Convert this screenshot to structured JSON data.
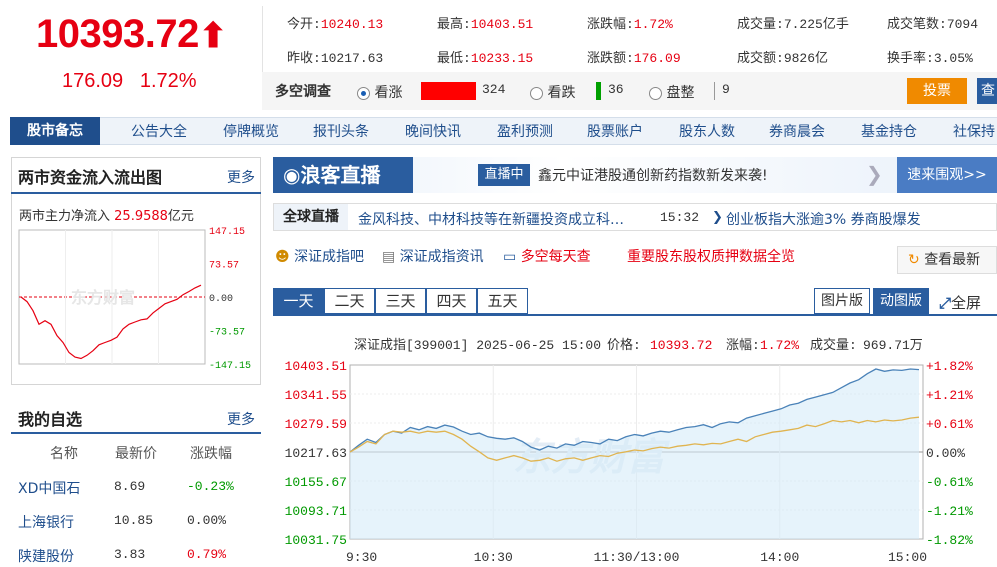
{
  "quote": {
    "price": "10393.72",
    "arrow": "⬆",
    "change": "176.09",
    "change_pct": "1.72%"
  },
  "stats": [
    {
      "label": "今开:",
      "value": "10240.13",
      "color": "red"
    },
    {
      "label": "最高:",
      "value": "10403.51",
      "color": "red"
    },
    {
      "label": "涨跌幅:",
      "value": "1.72%",
      "color": "red"
    },
    {
      "label": "成交量:",
      "value": "7.225亿手",
      "color": "black"
    },
    {
      "label": "成交笔数:",
      "value": "7094",
      "color": "black"
    },
    {
      "label": "昨收:",
      "value": "10217.63",
      "color": "black"
    },
    {
      "label": "最低:",
      "value": "10233.15",
      "color": "red"
    },
    {
      "label": "涨跌额:",
      "value": "176.09",
      "color": "red"
    },
    {
      "label": "成交额:",
      "value": "9826亿",
      "color": "black"
    },
    {
      "label": "换手率:",
      "value": "3.05%",
      "color": "black"
    }
  ],
  "poll": {
    "title": "多空调查",
    "bull_label": "看涨",
    "bull_count": "324",
    "bear_label": "看跌",
    "bear_count": "36",
    "flat_label": "盘整",
    "flat_count": "9",
    "vote_button": "投票",
    "extra_button": "查"
  },
  "nav": {
    "title": "股市备忘",
    "items": [
      "公告大全",
      "停牌概览",
      "报刊头条",
      "晚间快讯",
      "盈利预测",
      "股票账户",
      "股东人数",
      "券商晨会",
      "基金持仓",
      "社保持"
    ]
  },
  "flow_panel": {
    "title": "两市资金流入流出图",
    "more": "更多",
    "subtitle_prefix": "两市主力净流入",
    "net_value": "25.9588",
    "unit": "亿元",
    "y_ticks": [
      "147.15",
      "73.57",
      "0.00",
      "-73.57",
      "-147.15"
    ],
    "watermark": "东方财富"
  },
  "watchlist": {
    "title": "我的自选",
    "more": "更多",
    "headers": [
      "名称",
      "最新价",
      "涨跌幅"
    ],
    "rows": [
      {
        "name": "XD中国石",
        "price": "8.69",
        "pct": "-0.23%",
        "color": "green"
      },
      {
        "name": "上海银行",
        "price": "10.85",
        "pct": "0.00%",
        "color": "black"
      },
      {
        "name": "陕建股份",
        "price": "3.83",
        "pct": "0.79%",
        "color": "red"
      }
    ]
  },
  "banner": {
    "logo": "浪客直播",
    "tag": "直播中",
    "headline": "鑫元中证港股通创新药指数新发来袭!",
    "cta": "速来围观>>"
  },
  "ticker": {
    "label": "全球直播",
    "text": "金风科技、中材科技等在新疆投资成立科…",
    "time": "15:32",
    "text2": "创业板指大涨逾3% 券商股爆发"
  },
  "links": {
    "l1": "深证成指吧",
    "l2": "深证成指资讯",
    "l3": "多空每天查",
    "l4": "重要股东股权质押数据全览",
    "refresh": "查看最新"
  },
  "period_tabs": [
    "一天",
    "二天",
    "三天",
    "四天",
    "五天"
  ],
  "view_tabs": {
    "static": "图片版",
    "dynamic": "动图版",
    "fullscreen": "全屏"
  },
  "chart_data": {
    "type": "line",
    "title": "深证成指[399001] 2025-06-25 15:00",
    "info": {
      "price_label": "价格:",
      "price": "10393.72",
      "pct_label": "涨幅:",
      "pct": "1.72%",
      "vol_label": "成交量:",
      "vol": "969.71万"
    },
    "y_ticks_left": [
      "10403.51",
      "10341.55",
      "10279.59",
      "10217.63",
      "10155.67",
      "10093.71",
      "10031.75"
    ],
    "y_ticks_right": [
      "+1.82%",
      "+1.21%",
      "+0.61%",
      "0.00%",
      "-0.61%",
      "-1.21%",
      "-1.82%"
    ],
    "x_ticks": [
      "9:30",
      "10:30",
      "11:30/13:00",
      "14:00",
      "15:00"
    ],
    "ylim": [
      10031.75,
      10403.51
    ],
    "baseline": 10217.63,
    "watermark": "东方财富",
    "series": [
      {
        "values": [
          10217.63,
          10232,
          10245,
          10238,
          10255,
          10262,
          10258,
          10270,
          10265,
          10272,
          10268,
          10275,
          10271,
          10262,
          10255,
          10258,
          10250,
          10247,
          10245,
          10248,
          10240,
          10228,
          10222,
          10230,
          10226,
          10235,
          10232,
          10240,
          10238,
          10235,
          10245,
          10242,
          10250,
          10255,
          10252,
          10258,
          10262,
          10260,
          10265,
          10270,
          10272,
          10276,
          10270,
          10278,
          10282,
          10280,
          10290,
          10295,
          10300,
          10305,
          10310,
          10318,
          10322,
          10330,
          10335,
          10340,
          10345,
          10355,
          10365,
          10372,
          10385,
          10395,
          10390,
          10393,
          10392,
          10395,
          10393.72
        ]
      },
      {
        "values": [
          10217.63,
          10228,
          10240,
          10235,
          10255,
          10262,
          10260,
          10262,
          10258,
          10262,
          10260,
          10262,
          10255,
          10245,
          10230,
          10218,
          10205,
          10200,
          10205,
          10210,
          10205,
          10198,
          10200,
          10205,
          10198,
          10203,
          10205,
          10200,
          10205,
          10210,
          10208,
          10215,
          10218,
          10222,
          10220,
          10225,
          10228,
          10226,
          10230,
          10232,
          10235,
          10233,
          10236,
          10235,
          10240,
          10245,
          10240,
          10250,
          10255,
          10260,
          10262,
          10265,
          10268,
          10275,
          10272,
          10278,
          10285,
          10282,
          10285,
          10280,
          10285,
          10282,
          10286,
          10284,
          10286,
          10290,
          10292
        ]
      }
    ]
  },
  "flow_series": [
    0,
    -10,
    -30,
    -60,
    -52,
    -60,
    -85,
    -100,
    -122,
    -132,
    -135,
    -128,
    -118,
    -105,
    -100,
    -95,
    -88,
    -70,
    -60,
    -55,
    -50,
    -48,
    -35,
    -25,
    -15,
    -10,
    -5,
    5,
    12,
    20,
    25.96
  ]
}
